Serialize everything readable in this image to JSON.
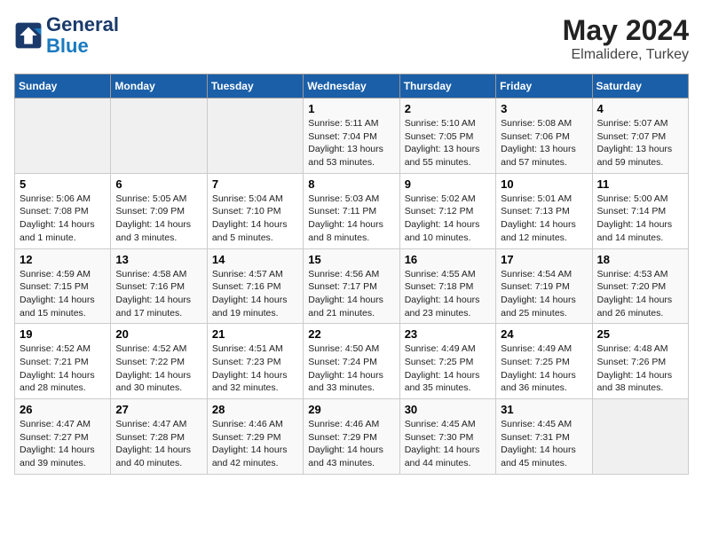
{
  "header": {
    "logo_line1": "General",
    "logo_line2": "Blue",
    "title": "May 2024",
    "subtitle": "Elmalidere, Turkey"
  },
  "weekdays": [
    "Sunday",
    "Monday",
    "Tuesday",
    "Wednesday",
    "Thursday",
    "Friday",
    "Saturday"
  ],
  "weeks": [
    [
      {
        "day": "",
        "info": ""
      },
      {
        "day": "",
        "info": ""
      },
      {
        "day": "",
        "info": ""
      },
      {
        "day": "1",
        "info": "Sunrise: 5:11 AM\nSunset: 7:04 PM\nDaylight: 13 hours and 53 minutes."
      },
      {
        "day": "2",
        "info": "Sunrise: 5:10 AM\nSunset: 7:05 PM\nDaylight: 13 hours and 55 minutes."
      },
      {
        "day": "3",
        "info": "Sunrise: 5:08 AM\nSunset: 7:06 PM\nDaylight: 13 hours and 57 minutes."
      },
      {
        "day": "4",
        "info": "Sunrise: 5:07 AM\nSunset: 7:07 PM\nDaylight: 13 hours and 59 minutes."
      }
    ],
    [
      {
        "day": "5",
        "info": "Sunrise: 5:06 AM\nSunset: 7:08 PM\nDaylight: 14 hours and 1 minute."
      },
      {
        "day": "6",
        "info": "Sunrise: 5:05 AM\nSunset: 7:09 PM\nDaylight: 14 hours and 3 minutes."
      },
      {
        "day": "7",
        "info": "Sunrise: 5:04 AM\nSunset: 7:10 PM\nDaylight: 14 hours and 5 minutes."
      },
      {
        "day": "8",
        "info": "Sunrise: 5:03 AM\nSunset: 7:11 PM\nDaylight: 14 hours and 8 minutes."
      },
      {
        "day": "9",
        "info": "Sunrise: 5:02 AM\nSunset: 7:12 PM\nDaylight: 14 hours and 10 minutes."
      },
      {
        "day": "10",
        "info": "Sunrise: 5:01 AM\nSunset: 7:13 PM\nDaylight: 14 hours and 12 minutes."
      },
      {
        "day": "11",
        "info": "Sunrise: 5:00 AM\nSunset: 7:14 PM\nDaylight: 14 hours and 14 minutes."
      }
    ],
    [
      {
        "day": "12",
        "info": "Sunrise: 4:59 AM\nSunset: 7:15 PM\nDaylight: 14 hours and 15 minutes."
      },
      {
        "day": "13",
        "info": "Sunrise: 4:58 AM\nSunset: 7:16 PM\nDaylight: 14 hours and 17 minutes."
      },
      {
        "day": "14",
        "info": "Sunrise: 4:57 AM\nSunset: 7:16 PM\nDaylight: 14 hours and 19 minutes."
      },
      {
        "day": "15",
        "info": "Sunrise: 4:56 AM\nSunset: 7:17 PM\nDaylight: 14 hours and 21 minutes."
      },
      {
        "day": "16",
        "info": "Sunrise: 4:55 AM\nSunset: 7:18 PM\nDaylight: 14 hours and 23 minutes."
      },
      {
        "day": "17",
        "info": "Sunrise: 4:54 AM\nSunset: 7:19 PM\nDaylight: 14 hours and 25 minutes."
      },
      {
        "day": "18",
        "info": "Sunrise: 4:53 AM\nSunset: 7:20 PM\nDaylight: 14 hours and 26 minutes."
      }
    ],
    [
      {
        "day": "19",
        "info": "Sunrise: 4:52 AM\nSunset: 7:21 PM\nDaylight: 14 hours and 28 minutes."
      },
      {
        "day": "20",
        "info": "Sunrise: 4:52 AM\nSunset: 7:22 PM\nDaylight: 14 hours and 30 minutes."
      },
      {
        "day": "21",
        "info": "Sunrise: 4:51 AM\nSunset: 7:23 PM\nDaylight: 14 hours and 32 minutes."
      },
      {
        "day": "22",
        "info": "Sunrise: 4:50 AM\nSunset: 7:24 PM\nDaylight: 14 hours and 33 minutes."
      },
      {
        "day": "23",
        "info": "Sunrise: 4:49 AM\nSunset: 7:25 PM\nDaylight: 14 hours and 35 minutes."
      },
      {
        "day": "24",
        "info": "Sunrise: 4:49 AM\nSunset: 7:25 PM\nDaylight: 14 hours and 36 minutes."
      },
      {
        "day": "25",
        "info": "Sunrise: 4:48 AM\nSunset: 7:26 PM\nDaylight: 14 hours and 38 minutes."
      }
    ],
    [
      {
        "day": "26",
        "info": "Sunrise: 4:47 AM\nSunset: 7:27 PM\nDaylight: 14 hours and 39 minutes."
      },
      {
        "day": "27",
        "info": "Sunrise: 4:47 AM\nSunset: 7:28 PM\nDaylight: 14 hours and 40 minutes."
      },
      {
        "day": "28",
        "info": "Sunrise: 4:46 AM\nSunset: 7:29 PM\nDaylight: 14 hours and 42 minutes."
      },
      {
        "day": "29",
        "info": "Sunrise: 4:46 AM\nSunset: 7:29 PM\nDaylight: 14 hours and 43 minutes."
      },
      {
        "day": "30",
        "info": "Sunrise: 4:45 AM\nSunset: 7:30 PM\nDaylight: 14 hours and 44 minutes."
      },
      {
        "day": "31",
        "info": "Sunrise: 4:45 AM\nSunset: 7:31 PM\nDaylight: 14 hours and 45 minutes."
      },
      {
        "day": "",
        "info": ""
      }
    ]
  ]
}
